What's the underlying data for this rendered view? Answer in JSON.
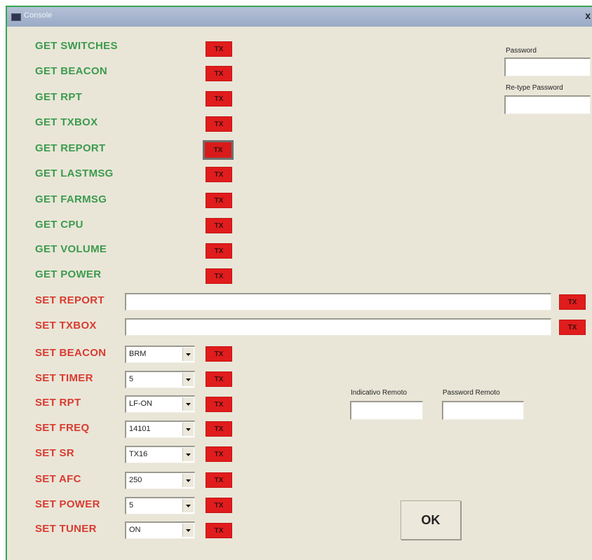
{
  "window": {
    "title": "Console",
    "close_glyph": "x"
  },
  "get_commands": [
    {
      "label": "GET SWITCHES",
      "button": "TX"
    },
    {
      "label": "GET BEACON",
      "button": "TX"
    },
    {
      "label": "GET RPT",
      "button": "TX"
    },
    {
      "label": "GET TXBOX",
      "button": "TX"
    },
    {
      "label": "GET REPORT",
      "button": "TX"
    },
    {
      "label": "GET LASTMSG",
      "button": "TX"
    },
    {
      "label": "GET FARMSG",
      "button": "TX"
    },
    {
      "label": "GET CPU",
      "button": "TX"
    },
    {
      "label": "GET VOLUME",
      "button": "TX"
    },
    {
      "label": "GET POWER",
      "button": "TX"
    }
  ],
  "set_text_commands": [
    {
      "label": "SET REPORT",
      "value": "",
      "button": "TX"
    },
    {
      "label": "SET TXBOX",
      "value": "",
      "button": "TX"
    }
  ],
  "set_combo_commands": [
    {
      "label": "SET BEACON",
      "value": "BRM",
      "button": "TX"
    },
    {
      "label": "SET TIMER",
      "value": "5",
      "button": "TX"
    },
    {
      "label": "SET RPT",
      "value": "LF-ON",
      "button": "TX"
    },
    {
      "label": "SET FREQ",
      "value": "14101",
      "button": "TX"
    },
    {
      "label": "SET SR",
      "value": "TX16",
      "button": "TX"
    },
    {
      "label": "SET AFC",
      "value": "250",
      "button": "TX"
    },
    {
      "label": "SET POWER",
      "value": "5",
      "button": "TX"
    },
    {
      "label": "SET TUNER",
      "value": "ON",
      "button": "TX"
    }
  ],
  "password": {
    "label": "Password",
    "value": "",
    "retype_label": "Re-type Password",
    "retype_value": ""
  },
  "remote": {
    "callsign_label": "Indicativo Remoto",
    "callsign_value": "",
    "password_label": "Password Remoto",
    "password_value": ""
  },
  "ok_label": "OK",
  "icons": {
    "window_icon": "console-window-icon",
    "close": "close-icon",
    "combo_arrow": "chevron-down-icon"
  },
  "colors": {
    "get_label": "#3d9a4e",
    "set_label": "#d93b30",
    "tx_button": "#e01c1c",
    "background": "#e9e6d8"
  }
}
